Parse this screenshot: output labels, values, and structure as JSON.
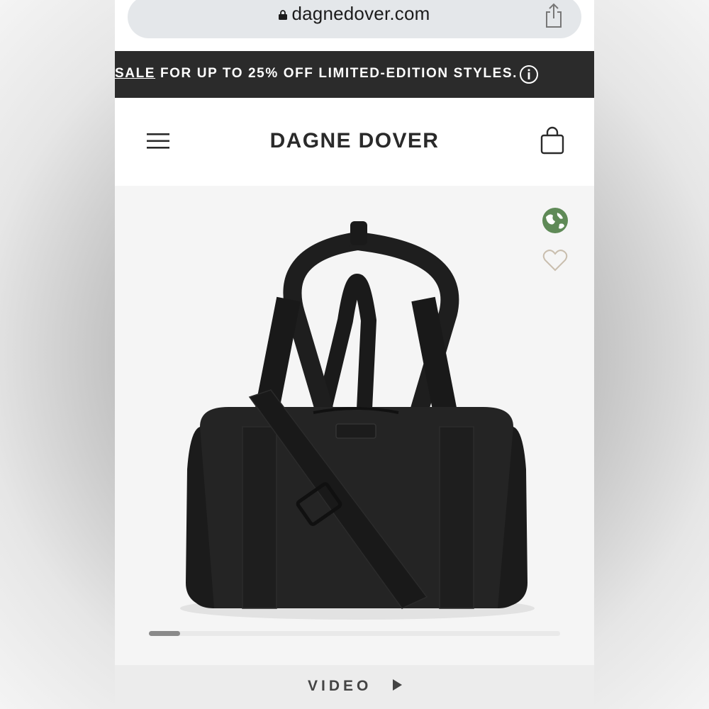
{
  "browser": {
    "url": "dagnedover.com",
    "icons": {
      "lock": "lock-icon",
      "share": "share-icon"
    }
  },
  "promo_banner": {
    "sale_link": "SALE",
    "text": " FOR UP TO 25% OFF LIMITED-EDITION STYLES.",
    "icon": "info-icon",
    "background": "#2b2b2b"
  },
  "header": {
    "brand": "DAGNE DOVER",
    "icons": {
      "menu": "menu-icon",
      "cart": "shopping-bag-icon"
    }
  },
  "product": {
    "image": "black-duffle-bag",
    "badge_icon": "globe-icon",
    "wishlist_icon": "heart-icon",
    "gallery_progress": 0.08
  },
  "video": {
    "label": "VIDEO",
    "icon": "play-icon"
  }
}
